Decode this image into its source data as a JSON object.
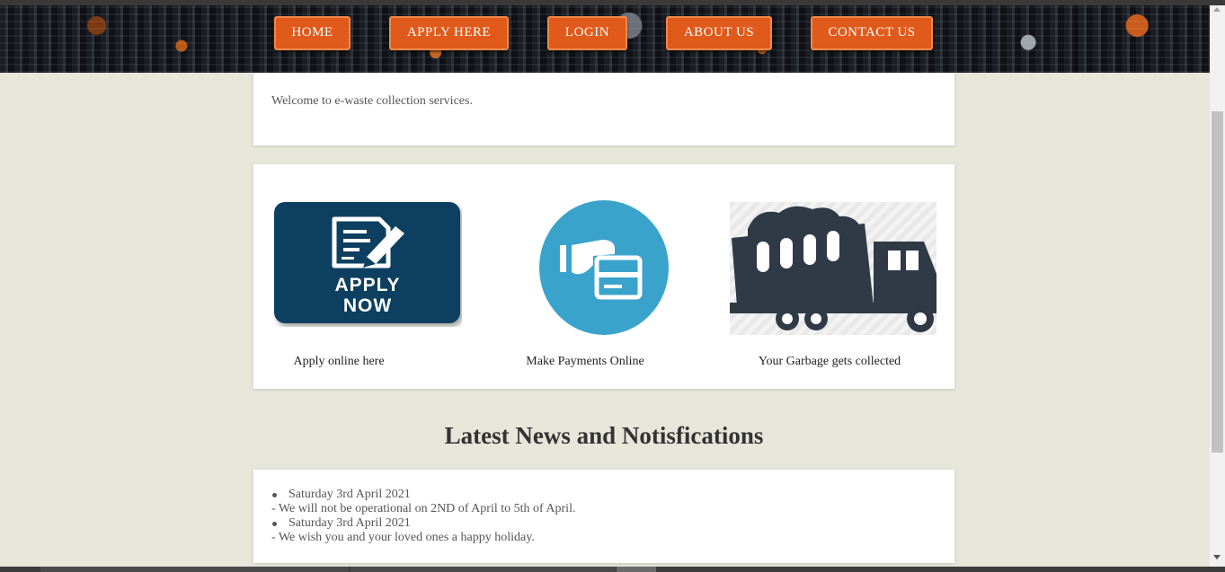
{
  "nav": {
    "items": [
      {
        "label": "HOME"
      },
      {
        "label": "APPLY HERE"
      },
      {
        "label": "LOGIN"
      },
      {
        "label": "ABOUT US"
      },
      {
        "label": "CONTACT US"
      }
    ]
  },
  "welcome": {
    "text": "Welcome to e-waste collection services."
  },
  "features": [
    {
      "icon": "apply-now-icon",
      "image_text_line1": "APPLY",
      "image_text_line2": "NOW",
      "caption": "Apply online here"
    },
    {
      "icon": "payment-card-icon",
      "caption": "Make Payments Online"
    },
    {
      "icon": "garbage-truck-icon",
      "caption": "Your Garbage gets collected"
    }
  ],
  "news": {
    "title": "Latest News and Notisfications",
    "items": [
      {
        "date": "Saturday 3rd April 2021",
        "text": "- We will not be operational on 2ND of April to 5th of April."
      },
      {
        "date": "Saturday 3rd April 2021",
        "text": "- We wish you and your loved ones a happy holiday."
      }
    ]
  },
  "colors": {
    "page_bg": "#e6e6da",
    "nav_button": "#e05a1b",
    "apply_tile": "#0c4160",
    "payment_circle": "#3aa3cc",
    "truck": "#2f3a46"
  }
}
